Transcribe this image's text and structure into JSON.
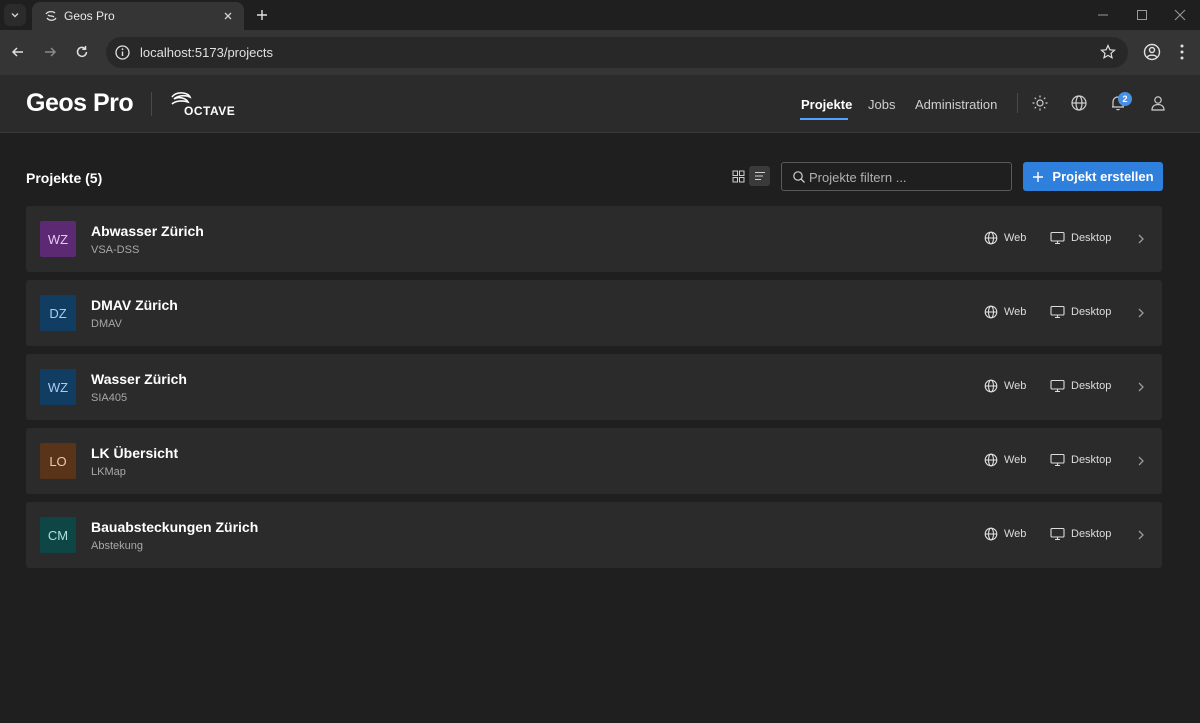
{
  "browser": {
    "tab_title": "Geos Pro",
    "url": "localhost:5173/projects"
  },
  "header": {
    "brand": "Geos Pro",
    "partner_logo_text": "OCTAVE",
    "nav": [
      {
        "label": "Projekte",
        "active": true
      },
      {
        "label": "Jobs",
        "active": false
      },
      {
        "label": "Administration",
        "active": false
      }
    ],
    "notification_count": "2"
  },
  "main": {
    "title": "Projekte (5)",
    "filter_placeholder": "Projekte filtern ...",
    "create_button": "Projekt erstellen",
    "projects": [
      {
        "initials": "WZ",
        "name": "Abwasser Zürich",
        "model": "VSA-DSS",
        "color": "#5c2a73",
        "text_color": "#e6c8f2"
      },
      {
        "initials": "DZ",
        "name": "DMAV Zürich",
        "model": "DMAV",
        "color": "#123d63",
        "text_color": "#a9cdf0"
      },
      {
        "initials": "WZ",
        "name": "Wasser Zürich",
        "model": "SIA405",
        "color": "#123d63",
        "text_color": "#a9cdf0"
      },
      {
        "initials": "LO",
        "name": "LK Übersicht",
        "model": "LKMap",
        "color": "#5a3418",
        "text_color": "#f0c9a8"
      },
      {
        "initials": "CM",
        "name": "Bauabsteckungen Zürich",
        "model": "Abstekung",
        "color": "#0e4545",
        "text_color": "#a8e0e0"
      }
    ],
    "web_label": "Web",
    "desktop_label": "Desktop"
  },
  "colors": {
    "accent": "#2f7fdc",
    "page_bg": "#1f1f1f",
    "card_bg": "#2b2b2b"
  }
}
